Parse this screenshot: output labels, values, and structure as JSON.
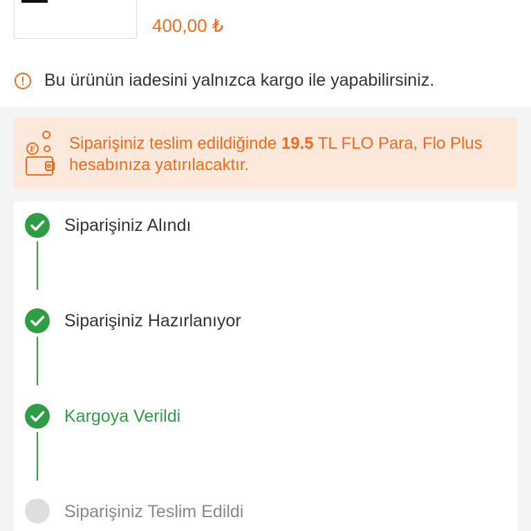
{
  "product": {
    "price": "400,00 ₺"
  },
  "return_note": {
    "icon": "info-circle-icon",
    "text": "Bu ürünün iadesini yalnızca kargo ile yapabilirsiniz."
  },
  "cashback": {
    "icon": "wallet-coin-icon",
    "text_before": "Siparişiniz teslim edildiğinde ",
    "amount": "19.5",
    "text_after": " TL FLO Para, Flo Plus hesabınıza yatırılacaktır."
  },
  "order_status": {
    "steps": [
      {
        "label": "Siparişiniz Alındı",
        "state": "done"
      },
      {
        "label": "Siparişiniz Hazırlanıyor",
        "state": "done"
      },
      {
        "label": "Kargoya Verildi",
        "state": "current"
      },
      {
        "label": "Siparişiniz Teslim Edildi",
        "state": "pending"
      }
    ]
  },
  "colors": {
    "accent": "#f26b1d",
    "success": "#2e9e44",
    "cashback_bg": "#fde8dc",
    "pending": "#dedede"
  }
}
